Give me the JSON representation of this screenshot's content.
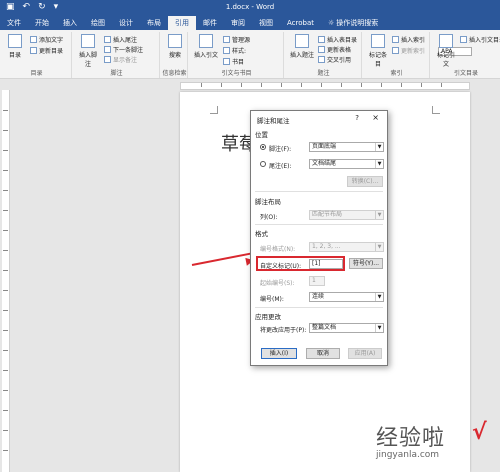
{
  "window": {
    "title": "1.docx - Word"
  },
  "tabs": [
    "文件",
    "开始",
    "插入",
    "绘图",
    "设计",
    "布局",
    "引用",
    "邮件",
    "审阅",
    "视图",
    "Acrobat",
    "操作说明搜索"
  ],
  "active_tab": "引用",
  "ribbon": {
    "toc": {
      "label": "目录",
      "add_text": "添加文字",
      "update": "更新目录",
      "group": "目录"
    },
    "footnotes": {
      "insert_footnote": "插入脚注",
      "insert_endnote": "插入尾注",
      "next_footnote": "下一条脚注",
      "show_notes": "显示备注",
      "group": "脚注"
    },
    "research": {
      "search": "搜索",
      "group": "信息检索"
    },
    "citations": {
      "insert_citation": "插入引文",
      "manage_sources": "管理源",
      "style_label": "样式:",
      "style_value": "APA",
      "bibliography": "书目",
      "group": "引文与书目"
    },
    "captions": {
      "insert_caption": "插入题注",
      "insert_table_of_figures": "插入表目录",
      "update_table": "更新表格",
      "cross_reference": "交叉引用",
      "group": "题注"
    },
    "index": {
      "mark_entry": "标记条目",
      "insert_index": "插入索引",
      "update_index": "更新索引",
      "group": "索引"
    },
    "authorities": {
      "mark_citation": "标记引文",
      "insert_table": "插入引文目录",
      "group": "引文目录"
    }
  },
  "document": {
    "heading": "草莓"
  },
  "dialog": {
    "title": "脚注和尾注",
    "help": "?",
    "close": "×",
    "location_section": "位置",
    "footnotes_label": "脚注(F):",
    "footnotes_value": "页面底端",
    "endnotes_label": "尾注(E):",
    "endnotes_value": "文档结尾",
    "convert_button": "转换(C)...",
    "layout_section": "脚注布局",
    "columns_label": "列(O):",
    "columns_value": "匹配节布局",
    "format_section": "格式",
    "number_format_label": "编号格式(N):",
    "number_format_value": "1, 2, 3, ...",
    "custom_mark_label": "自定义标记(U):",
    "custom_mark_value": "[1]",
    "symbol_button": "符号(Y)...",
    "start_at_label": "起始编号(S):",
    "start_at_value": "1",
    "numbering_label": "编号(M):",
    "numbering_value": "连续",
    "apply_section": "应用更改",
    "apply_to_label": "将更改应用于(P):",
    "apply_to_value": "整篇文档",
    "insert_button": "插入(I)",
    "cancel_button": "取消",
    "apply_button": "应用(A)"
  },
  "watermark": {
    "text": "经验啦",
    "check": "√",
    "url": "jingyanla.com"
  },
  "colors": {
    "title_bar": "#2b579a",
    "highlight": "#d9282f"
  }
}
